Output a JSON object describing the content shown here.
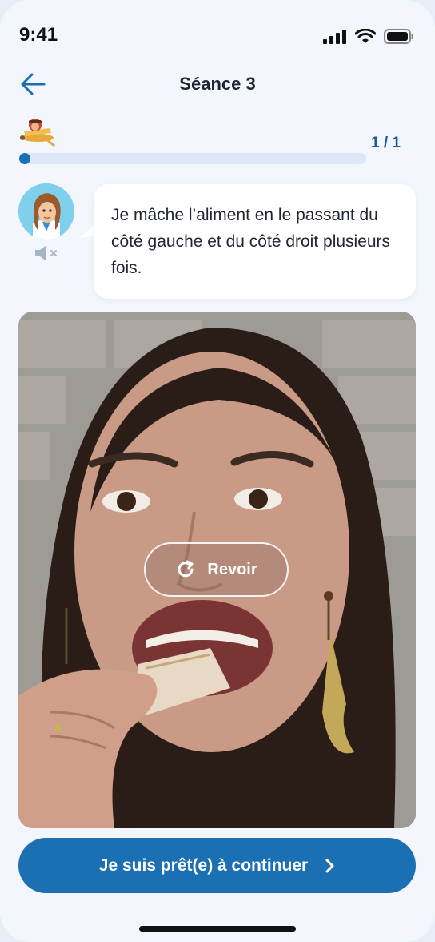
{
  "status_bar": {
    "time": "9:41"
  },
  "header": {
    "title": "Séance 3"
  },
  "progress": {
    "fraction": 0.0,
    "count": "1 / 1"
  },
  "coach": {
    "message": "Je mâche l’aliment en le passant du côté gauche et du côté droit plusieurs fois."
  },
  "video": {
    "replay_label": "Revoir"
  },
  "footer": {
    "continue_label": "Je suis prêt(e) à continuer"
  },
  "colors": {
    "primary": "#1b6fb3",
    "background": "#f3f7fd",
    "track": "#dde7f7"
  },
  "icons": [
    "back-arrow-icon",
    "plane-icon",
    "speaker-muted-icon",
    "replay-icon",
    "chevron-right-icon",
    "signal-icon",
    "wifi-icon",
    "battery-icon"
  ]
}
